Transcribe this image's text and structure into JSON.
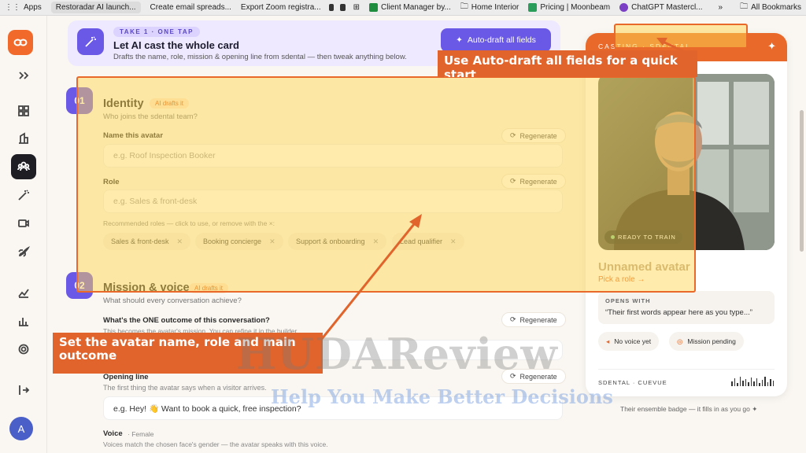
{
  "bookmarks": {
    "apps": "Apps",
    "items": [
      {
        "label": "Restoradar AI launch...",
        "active": true
      },
      {
        "label": "Create email spreads..."
      },
      {
        "label": "Export Zoom registra..."
      }
    ],
    "more_items": [
      {
        "label": "Client Manager by..."
      },
      {
        "label": "Home Interior"
      },
      {
        "label": "Pricing | Moonbeam"
      },
      {
        "label": "ChatGPT Mastercl..."
      }
    ],
    "overflow": "»",
    "all_bookmarks": "All Bookmarks"
  },
  "topcard": {
    "badge": "TAKE 1 · ONE TAP",
    "title": "Let AI cast the whole card",
    "subtitle": "Drafts the name, role, mission & opening line from sdental — then tweak anything below.",
    "auto_button": "Auto-draft all fields"
  },
  "identity": {
    "num": "01",
    "title": "Identity",
    "ai_badge": "AI drafts it",
    "subtitle": "Who joins the sdental team?",
    "name_label": "Name this avatar",
    "name_placeholder": "e.g. Roof Inspection Booker",
    "role_label": "Role",
    "role_placeholder": "e.g. Sales & front-desk",
    "regenerate": "Regenerate",
    "recommended_note": "Recommended roles — click to use, or remove with the ×:",
    "roles": [
      "Sales & front-desk",
      "Booking concierge",
      "Support & onboarding",
      "Lead qualifier"
    ]
  },
  "mission": {
    "num": "02",
    "title": "Mission & voice",
    "ai_badge": "AI drafts it",
    "subtitle": "What should every conversation achieve?",
    "outcome_label": "What's the ONE outcome of this conversation?",
    "outcome_note": "This becomes the avatar's mission. You can refine it in the builder.",
    "regenerate": "Regenerate",
    "opening_label": "Opening line",
    "opening_note": "The first thing the avatar says when a visitor arrives.",
    "opening_value": "e.g. Hey! 👋 Want to book a quick, free inspection?",
    "voice_label": "Voice",
    "voice_gender": "· Female",
    "voice_note": "Voices match the chosen face's gender — the avatar speaks with this voice."
  },
  "callouts": {
    "one": "Use Auto-draft all fields for a quick start",
    "two": "Set the avatar name, role and main outcome"
  },
  "preview": {
    "casting": "CASTING · SDENTAL",
    "ready": "READY TO TRAIN",
    "name": "Unnamed avatar",
    "role": "Pick a role →",
    "opens_label": "OPENS WITH",
    "opens_text": "“Their first words appear here as you type...”",
    "no_voice": "No voice yet",
    "mission_pending": "Mission pending",
    "footer": "SDENTAL · CUEVUE"
  },
  "ensemble_note": "Their ensemble badge — it fills in as you go ✦",
  "watermark": {
    "main": "HUDAReview",
    "tagline": "Help You Make Better Decisions"
  },
  "colors": {
    "accent": "#e8692a",
    "purple": "#6a58e6",
    "highlight": "#ffd650"
  }
}
